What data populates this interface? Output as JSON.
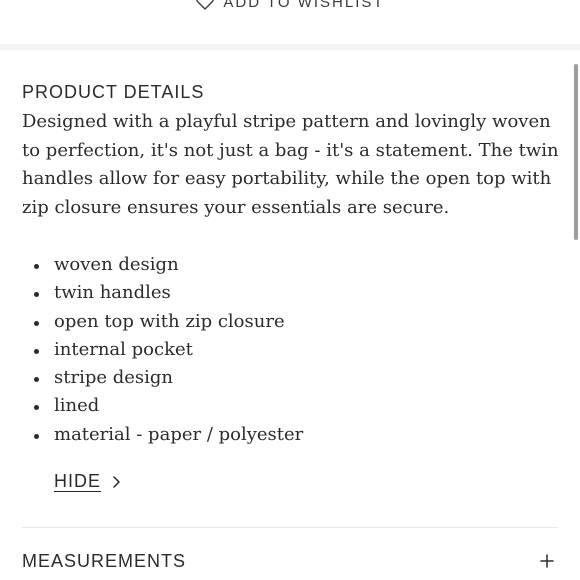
{
  "wishlist": {
    "label": "ADD TO WISHLIST",
    "icon": "heart-icon"
  },
  "product_details": {
    "title": "PRODUCT DETAILS",
    "description": "Designed with a playful stripe pattern and lovingly woven to perfection, it's not just a bag - it's a statement. The twin handles allow for easy portability, while the open top with zip closure ensures your essentials are secure.",
    "features": [
      "woven design",
      "twin handles",
      "open top with zip closure",
      "internal pocket",
      "stripe design",
      "lined",
      "material - paper / polyester"
    ],
    "toggle_label": "HIDE",
    "toggle_icon": "chevron-right-icon"
  },
  "measurements": {
    "title": "MEASUREMENTS",
    "expand_icon": "plus-icon"
  }
}
